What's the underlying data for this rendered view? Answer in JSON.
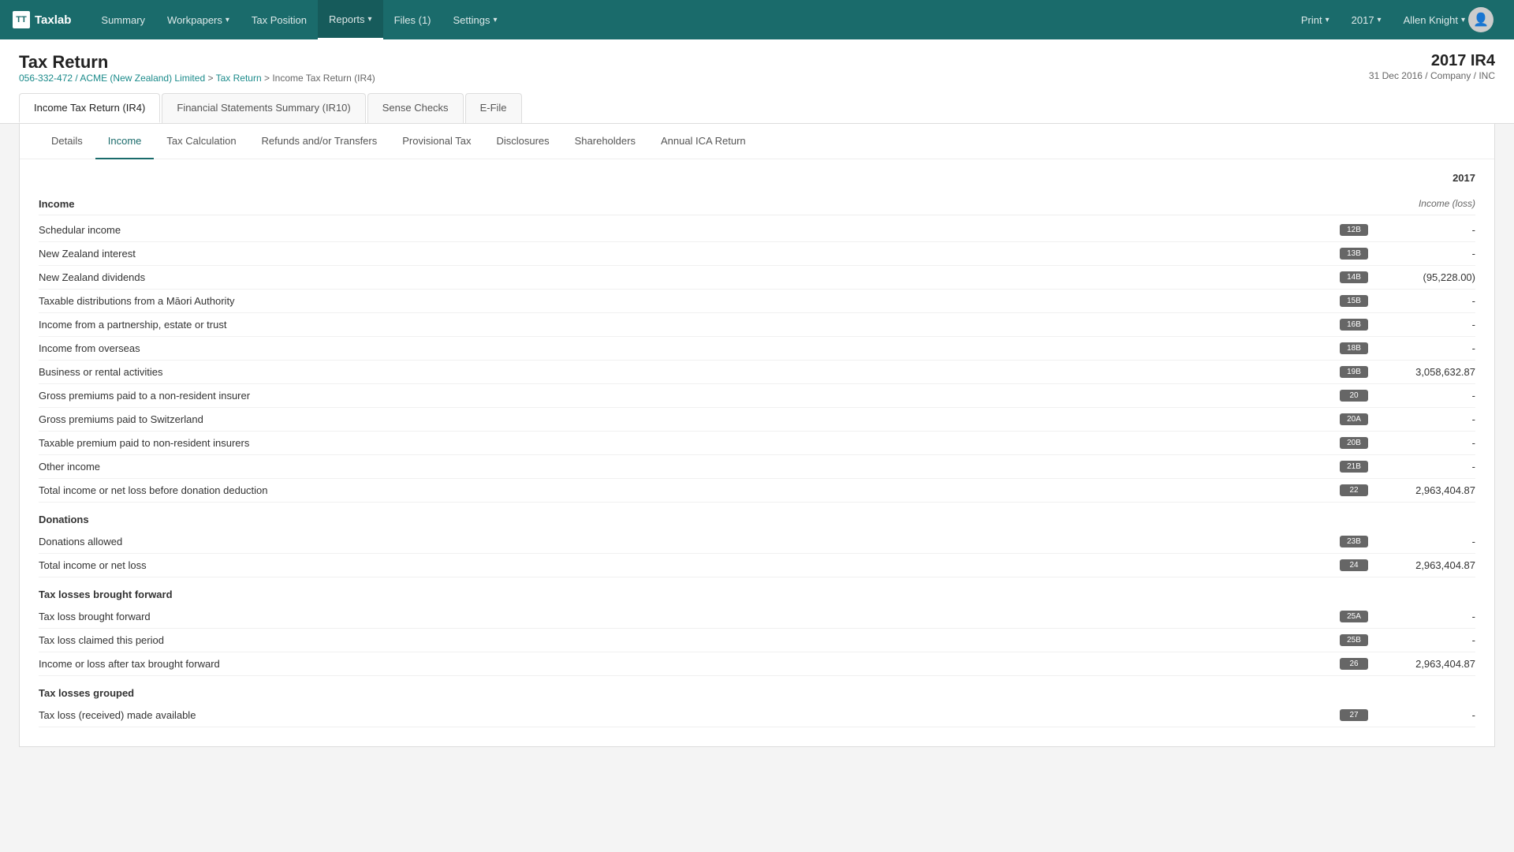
{
  "app": {
    "logo_text": "TT",
    "brand_name": "Taxlab"
  },
  "topnav": {
    "items": [
      {
        "label": "Summary",
        "active": false
      },
      {
        "label": "Workpapers",
        "dropdown": true,
        "active": false
      },
      {
        "label": "Tax Position",
        "active": false
      },
      {
        "label": "Reports",
        "dropdown": true,
        "active": true
      },
      {
        "label": "Files (1)",
        "active": false
      },
      {
        "label": "Settings",
        "dropdown": true,
        "active": false
      }
    ],
    "right_items": [
      {
        "label": "Print",
        "dropdown": true
      },
      {
        "label": "2017",
        "dropdown": true
      },
      {
        "label": "Allen Knight",
        "dropdown": true,
        "avatar": true
      }
    ]
  },
  "page": {
    "title": "Tax Return",
    "doc_id": "2017 IR4",
    "doc_sub": "31 Dec 2016 / Company / INC",
    "breadcrumb_company": "056-332-472 / ACME (New Zealand) Limited",
    "breadcrumb_return": "Tax Return",
    "breadcrumb_current": "Income Tax Return (IR4)"
  },
  "main_tabs": [
    {
      "label": "Income Tax Return (IR4)",
      "active": true
    },
    {
      "label": "Financial Statements Summary (IR10)",
      "active": false
    },
    {
      "label": "Sense Checks",
      "active": false
    },
    {
      "label": "E-File",
      "active": false
    }
  ],
  "sub_tabs": [
    {
      "label": "Details",
      "active": false
    },
    {
      "label": "Income",
      "active": true
    },
    {
      "label": "Tax Calculation",
      "active": false
    },
    {
      "label": "Refunds and/or Transfers",
      "active": false
    },
    {
      "label": "Provisional Tax",
      "active": false
    },
    {
      "label": "Disclosures",
      "active": false
    },
    {
      "label": "Shareholders",
      "active": false
    },
    {
      "label": "Annual ICA Return",
      "active": false
    }
  ],
  "year_label": "2017",
  "income_section": {
    "title": "Income",
    "col_label": "Income (loss)",
    "rows": [
      {
        "label": "Schedular income",
        "badge": "12B",
        "value": "-"
      },
      {
        "label": "New Zealand interest",
        "badge": "13B",
        "value": "-"
      },
      {
        "label": "New Zealand dividends",
        "badge": "14B",
        "value": "(95,228.00)"
      },
      {
        "label": "Taxable distributions from a Māori Authority",
        "badge": "15B",
        "value": "-"
      },
      {
        "label": "Income from a partnership, estate or trust",
        "badge": "16B",
        "value": "-"
      },
      {
        "label": "Income from overseas",
        "badge": "18B",
        "value": "-"
      },
      {
        "label": "Business or rental activities",
        "badge": "19B",
        "value": "3,058,632.87"
      },
      {
        "label": "Gross premiums paid to a non-resident insurer",
        "badge": "20",
        "value": "-"
      },
      {
        "label": "Gross premiums paid to Switzerland",
        "badge": "20A",
        "value": "-"
      },
      {
        "label": "Taxable premium paid to non-resident insurers",
        "badge": "20B",
        "value": "-"
      },
      {
        "label": "Other income",
        "badge": "21B",
        "value": "-"
      },
      {
        "label": "Total income or net loss before donation deduction",
        "badge": "22",
        "value": "2,963,404.87"
      }
    ]
  },
  "donations_section": {
    "title": "Donations",
    "rows": [
      {
        "label": "Donations allowed",
        "badge": "23B",
        "value": "-"
      },
      {
        "label": "Total income or net loss",
        "badge": "24",
        "value": "2,963,404.87"
      }
    ]
  },
  "tax_losses_forward_section": {
    "title": "Tax losses brought forward",
    "rows": [
      {
        "label": "Tax loss brought forward",
        "badge": "25A",
        "value": "-"
      },
      {
        "label": "Tax loss claimed this period",
        "badge": "25B",
        "value": "-"
      },
      {
        "label": "Income or loss after tax brought forward",
        "badge": "26",
        "value": "2,963,404.87"
      }
    ]
  },
  "tax_losses_grouped_section": {
    "title": "Tax losses grouped",
    "rows": [
      {
        "label": "Tax loss (received) made available",
        "badge": "27",
        "value": "-"
      }
    ]
  }
}
